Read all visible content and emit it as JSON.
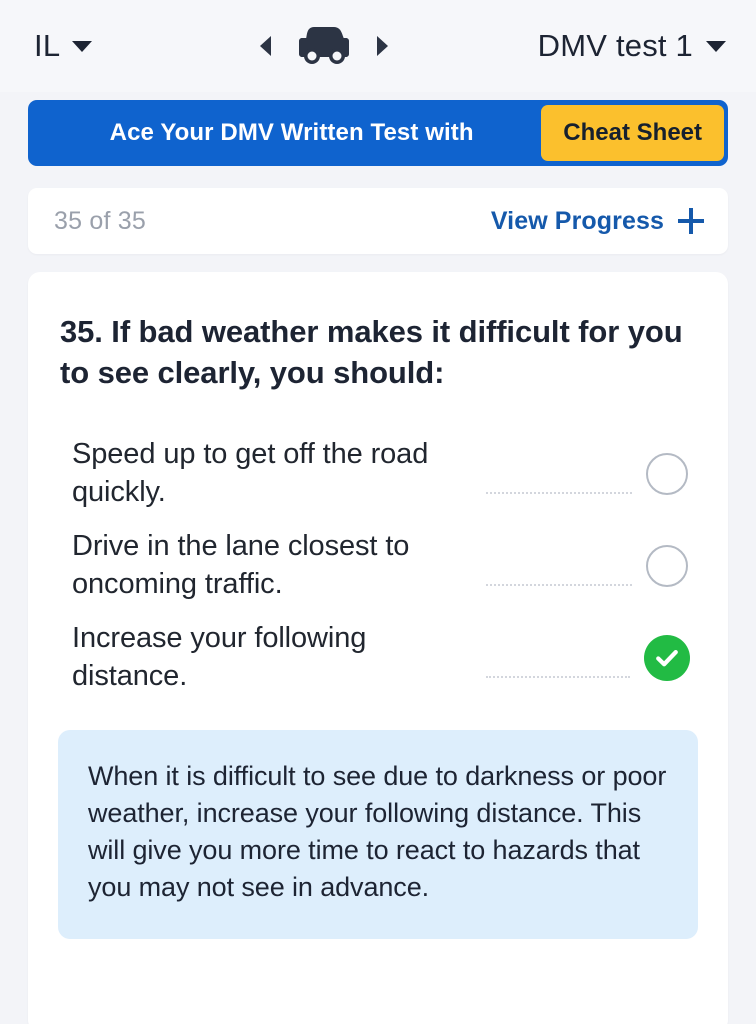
{
  "header": {
    "state_label": "IL",
    "state_caret_icon": "chevron-down-icon",
    "prev_arrow_icon": "triangle-left-icon",
    "vehicle_icon": "car-icon",
    "next_arrow_icon": "triangle-right-icon",
    "test_label": "DMV test 1",
    "test_caret_icon": "chevron-down-icon"
  },
  "promo": {
    "text": "Ace Your DMV Written Test with",
    "button_label": "Cheat Sheet",
    "banner_color": "#0f63ce",
    "button_color": "#fbc02d"
  },
  "progress": {
    "count_label": "35 of 35",
    "view_label": "View Progress",
    "plus_icon": "plus-icon",
    "link_color": "#1559ab"
  },
  "question": {
    "title": "35. If bad weather makes it difficult for you to see clearly, you should:",
    "answers": [
      {
        "text": "Speed up to get off the road quickly.",
        "state": "unselected",
        "marker_icon": "radio-empty-icon"
      },
      {
        "text": "Drive in the lane closest to oncoming traffic.",
        "state": "unselected",
        "marker_icon": "radio-empty-icon"
      },
      {
        "text": "Increase your following distance.",
        "state": "correct",
        "marker_icon": "check-circle-icon"
      }
    ],
    "explanation": "When it is difficult to see due to darkness or poor weather, increase your following distance. This will give you more time to react to hazards that you may not see in advance.",
    "correct_color": "#22bb44",
    "explanation_bg": "#ddeefc"
  }
}
